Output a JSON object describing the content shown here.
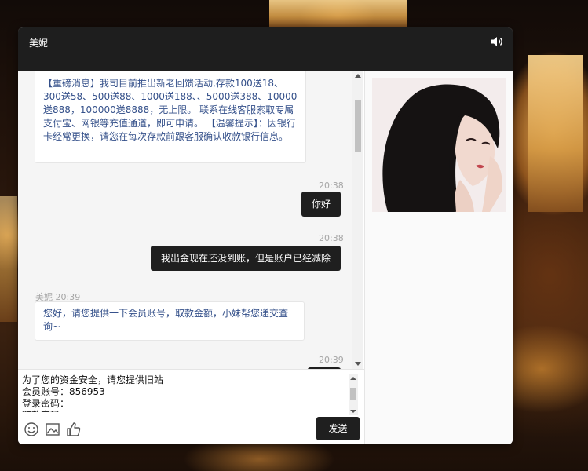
{
  "window": {
    "title": "美妮"
  },
  "messages": [
    {
      "kind": "agent",
      "sender": "",
      "time": "",
      "text": "【重磅消息】我司目前推出新老回馈活动,存款100送18、300送58、500送88、1000送188、、5000送388、10000送888，100000送8888，无上限。 联系在线客服索取专属支付宝、网银等充值通道，即可申请。 【温馨提示】：因银行卡经常更换，请您在每次存款前跟客服确认收款银行信息。"
    },
    {
      "kind": "user",
      "time": "20:38",
      "text": "你好"
    },
    {
      "kind": "user",
      "time": "20:38",
      "text": "我出金现在还没到账，但是账户已经减除"
    },
    {
      "kind": "agent",
      "sender": "美妮",
      "time": "20:39",
      "text": "您好，请您提供一下会员账号，取款金额，小妹帮您递交查询~"
    },
    {
      "kind": "user",
      "time": "20:39",
      "text": ""
    }
  ],
  "composer": {
    "input_text": "为了您的资金安全，请您提供旧站\n会员账号：856953\n登录密码：\n取款密码：",
    "send_label": "发送"
  },
  "icons": {
    "speaker": "speaker-icon",
    "emoji": "emoji-icon",
    "image": "image-icon",
    "thumbs_up": "thumbs-up-icon"
  },
  "colors": {
    "titlebar": "#1e1e1e",
    "outgoing_bubble": "#1f1f1f",
    "incoming_text": "#34508a"
  }
}
